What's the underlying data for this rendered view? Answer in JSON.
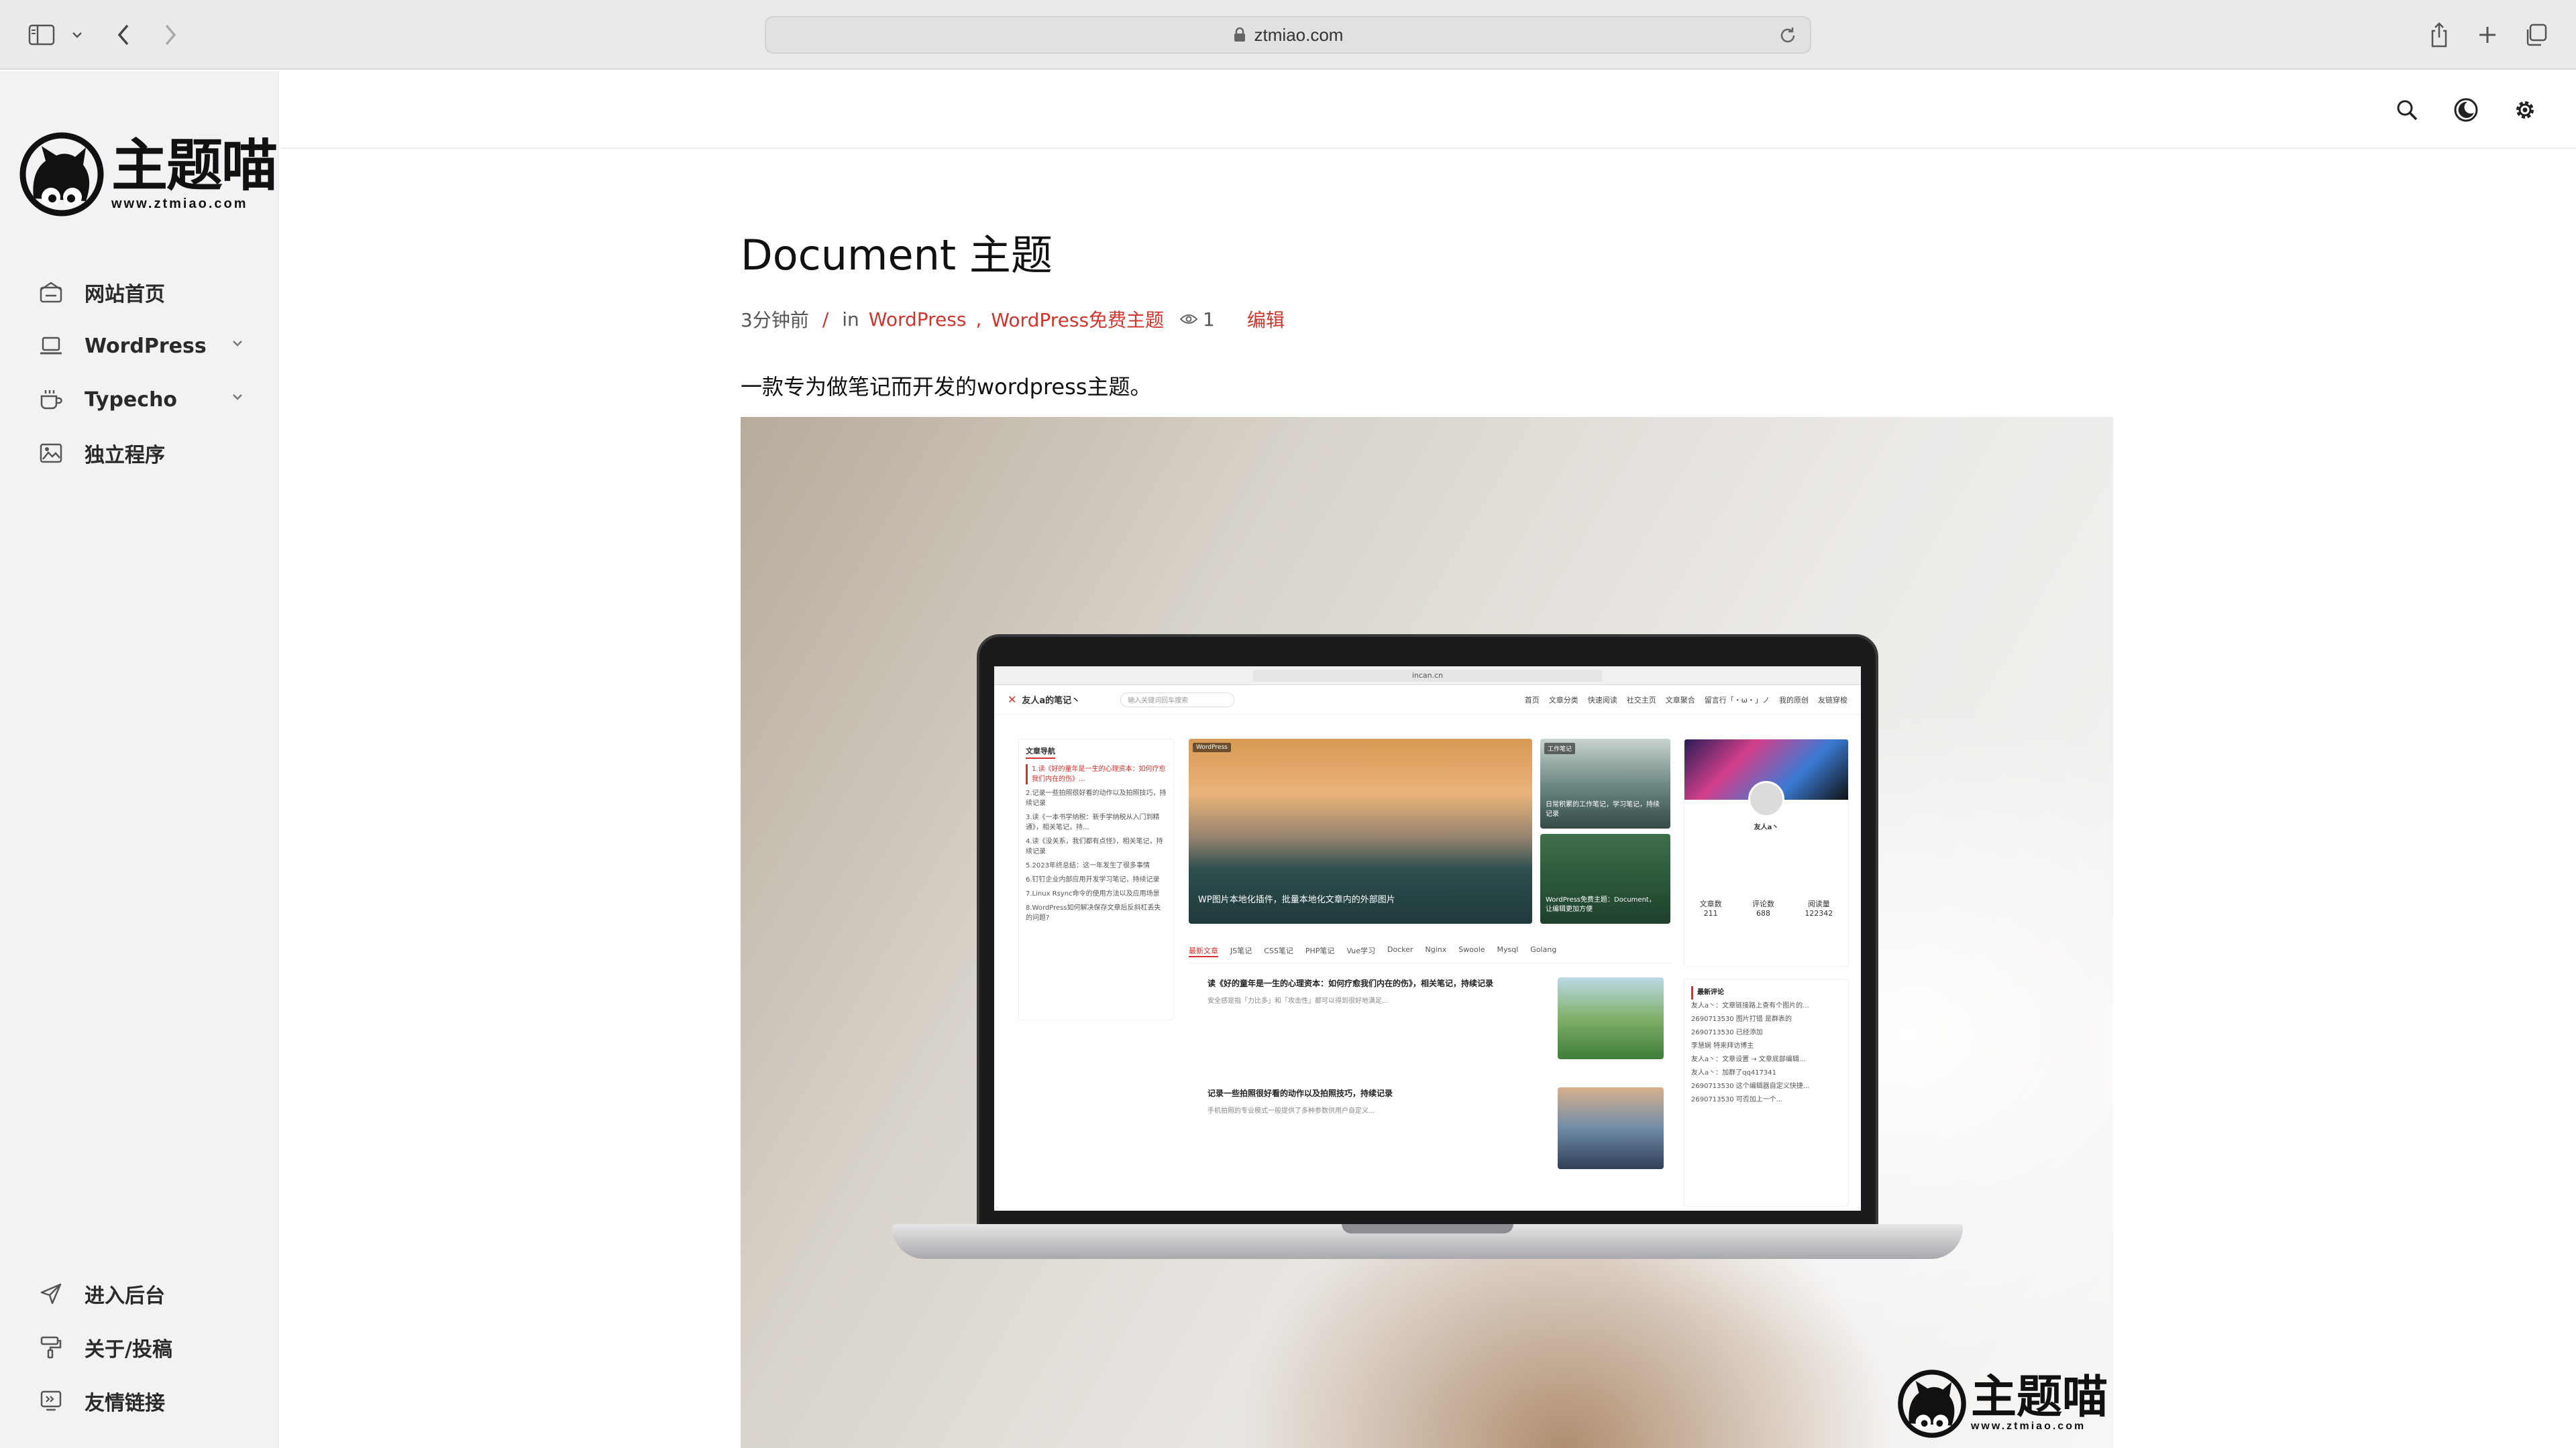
{
  "browser": {
    "url": "ztmiao.com"
  },
  "site": {
    "logo_text": "主题喵",
    "logo_url": "www.ztmiao.com"
  },
  "sidebar": {
    "items": [
      {
        "label": "网站首页",
        "icon": "home-icon"
      },
      {
        "label": "WordPress",
        "icon": "laptop-icon"
      },
      {
        "label": "Typecho",
        "icon": "coffee-icon"
      },
      {
        "label": "独立程序",
        "icon": "image-icon"
      }
    ],
    "bottom_items": [
      {
        "label": "进入后台",
        "icon": "send-icon"
      },
      {
        "label": "关于/投稿",
        "icon": "paint-roller-icon"
      },
      {
        "label": "友情链接",
        "icon": "link-card-icon"
      }
    ]
  },
  "topbar": {
    "icons": [
      "search-icon",
      "dark-mode-icon",
      "settings-icon"
    ]
  },
  "article": {
    "title": "Document 主题",
    "time": "3分钟前",
    "slash": "/",
    "in": "in",
    "cat1": "WordPress",
    "sep": ",",
    "cat2": "WordPress免费主题",
    "views": "1",
    "edit": "编辑",
    "description": "一款专为做笔记而开发的wordpress主题。"
  },
  "hero": {
    "watermark_text": "主题喵",
    "watermark_url": "www.ztmiao.com",
    "screen": {
      "url": "incan.cn",
      "brand": "友人a的笔记丶",
      "search_placeholder": "输入关键词回车搜索",
      "menu": [
        "首页",
        "文章分类",
        "快速阅读",
        "社交主页",
        "文章聚合",
        "留言行「・ω・」ノ",
        "我的原创",
        "友链穿梭"
      ],
      "nav_title": "文章导航",
      "nav_items": [
        "1.读《好的童年是一生的心理资本：如何疗愈我们内在的伤》...",
        "2.记录一些拍照很好看的动作以及拍照技巧，持续记录",
        "3.读《一本书学纳税：新手学纳税从入门到精通》，相关笔记，持...",
        "4.读《没关系，我们都有点怪》，相关笔记，持续记录",
        "5.2023年终总结：这一年发生了很多事情",
        "6.钉钉企业内部应用开发学习笔记，持续记录",
        "7.Linux Rsync命令的使用方法以及应用场景",
        "8.WordPress如何解决保存文章后反斜杠丢失的问题?"
      ],
      "feature_tag": "WordPress",
      "feature_caption": "WP图片本地化插件，批量本地化文章内的外部图片",
      "tile1_tag": "工作笔记",
      "tile1_caption": "日常积累的工作笔记，学习笔记，持续记录",
      "tile2_caption": "WordPress免费主题：Document，让编辑更加方便",
      "profile_name": "友人a丶",
      "stats": [
        {
          "label": "文章数",
          "value": "211"
        },
        {
          "label": "评论数",
          "value": "688"
        },
        {
          "label": "阅读量",
          "value": "122342"
        }
      ],
      "tabs": [
        "最新文章",
        "JS笔记",
        "CSS笔记",
        "PHP笔记",
        "Vue学习",
        "Docker",
        "Nginx",
        "Swoole",
        "Mysql",
        "Golang"
      ],
      "post1_title": "读《好的童年是一生的心理资本：如何疗愈我们内在的伤》，相关笔记，持续记录",
      "post1_excerpt": "安全感是指「力比多」和「攻击性」都可以得到很好地满足...",
      "post2_title": "记录一些拍照很好看的动作以及拍照技巧，持续记录",
      "post2_excerpt": "手机拍照的专业模式一般提供了多种参数供用户自定义...",
      "comments_title": "最新评论",
      "comments": [
        "友人a丶：文章链接路上查有个图片的...",
        "2690713530 图片打错 是群表的",
        "2690713530 已经添加",
        "李慧娴 特来拜访博主",
        "友人a丶：文章设置 → 文章底部编辑...",
        "友人a丶：加群了qq417341",
        "2690713530 这个编辑器自定义快捷...",
        "2690713530 可否加上一个..."
      ]
    }
  }
}
